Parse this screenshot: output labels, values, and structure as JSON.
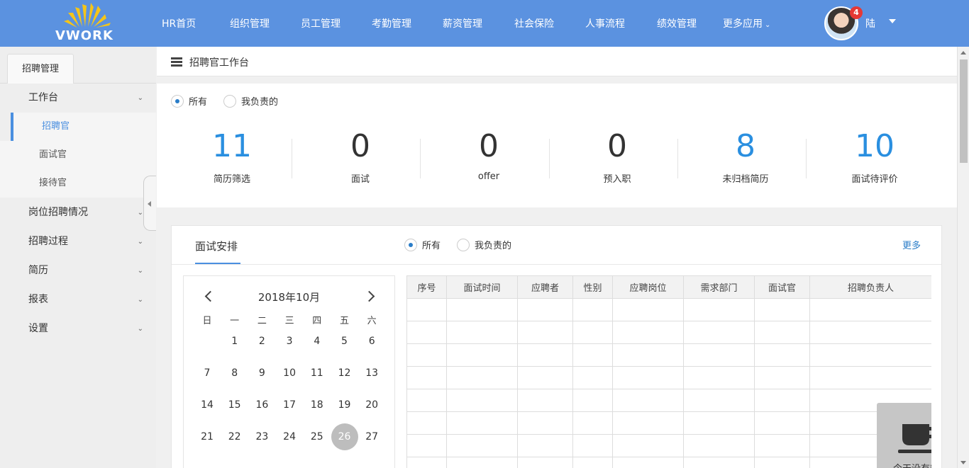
{
  "brand": {
    "logo_text": "VWORK",
    "nav_color": "#5b92e0",
    "accent": "#4a8fe0",
    "stat_blue": "#2a8fe0"
  },
  "nav": {
    "items": [
      "HR首页",
      "组织管理",
      "员工管理",
      "考勤管理",
      "薪资管理",
      "社会保险",
      "人事流程",
      "绩效管理",
      "更多应用"
    ],
    "more_icon": "chevron-down-icon"
  },
  "user": {
    "name": "陆",
    "notifications": "4"
  },
  "sidebar": {
    "tab": "招聘管理",
    "groups": [
      {
        "label": "工作台",
        "children": [
          "招聘官",
          "面试官",
          "接待官"
        ],
        "active_child": "招聘官"
      },
      {
        "label": "岗位招聘情况"
      },
      {
        "label": "招聘过程"
      },
      {
        "label": "简历"
      },
      {
        "label": "报表"
      },
      {
        "label": "设置"
      }
    ]
  },
  "page": {
    "title": "招聘官工作台"
  },
  "filter": {
    "options": [
      "所有",
      "我负责的"
    ],
    "selected": "所有"
  },
  "stats": [
    {
      "value": "11",
      "label": "简历筛选",
      "highlight": true
    },
    {
      "value": "0",
      "label": "面试",
      "highlight": false
    },
    {
      "value": "0",
      "label": "offer",
      "highlight": false
    },
    {
      "value": "0",
      "label": "预入职",
      "highlight": false
    },
    {
      "value": "8",
      "label": "未归档简历",
      "highlight": true
    },
    {
      "value": "10",
      "label": "面试待评价",
      "highlight": true
    }
  ],
  "schedule": {
    "title": "面试安排",
    "filter": {
      "options": [
        "所有",
        "我负责的"
      ],
      "selected": "所有"
    },
    "more": "更多",
    "calendar": {
      "title": "2018年10月",
      "weekdays": [
        "日",
        "一",
        "二",
        "三",
        "四",
        "五",
        "六"
      ],
      "weeks": [
        [
          "",
          "1",
          "2",
          "3",
          "4",
          "5",
          "6"
        ],
        [
          "7",
          "8",
          "9",
          "10",
          "11",
          "12",
          "13"
        ],
        [
          "14",
          "15",
          "16",
          "17",
          "18",
          "19",
          "20"
        ],
        [
          "21",
          "22",
          "23",
          "24",
          "25",
          "26",
          "27"
        ]
      ],
      "today": "26"
    },
    "table": {
      "columns": [
        "序号",
        "面试时间",
        "应聘者",
        "性别",
        "应聘岗位",
        "需求部门",
        "面试官",
        "招聘负责人"
      ],
      "empty_text": "今天没有安排",
      "empty_icon": "coffee-cup-icon"
    }
  }
}
